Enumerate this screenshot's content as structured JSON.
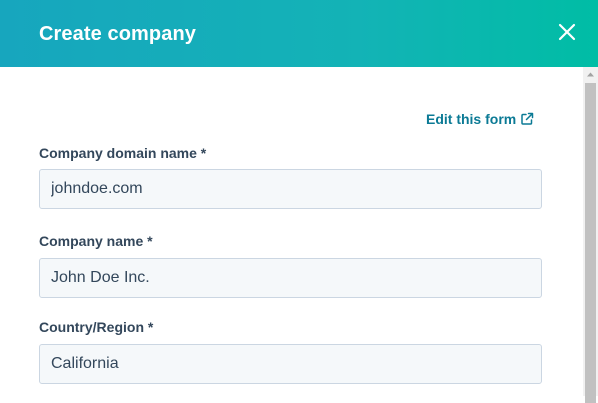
{
  "header": {
    "title": "Create company",
    "close_icon": "close-icon"
  },
  "form": {
    "edit_link_label": "Edit this form",
    "edit_link_icon": "external-link-icon",
    "fields": [
      {
        "label": "Company domain name *",
        "value": "johndoe.com"
      },
      {
        "label": "Company name *",
        "value": "John Doe Inc."
      },
      {
        "label": "Country/Region *",
        "value": "California"
      }
    ]
  },
  "colors": {
    "header_start": "#17a6be",
    "header_end": "#00bda5",
    "link": "#0b7a95",
    "label": "#33475b",
    "input_bg": "#f5f8fa",
    "input_border": "#cbd6e2"
  }
}
